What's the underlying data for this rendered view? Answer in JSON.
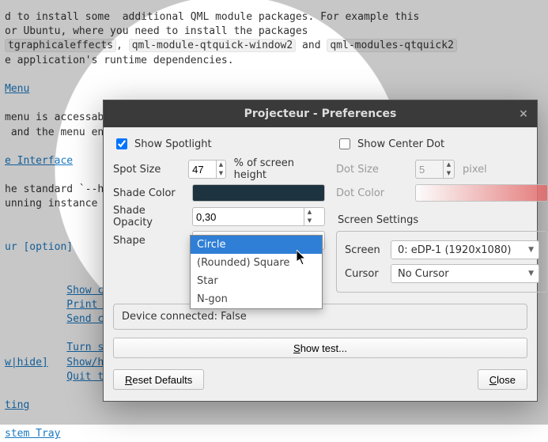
{
  "doc": {
    "line1a": "d to install some  additional QML module packages. For example this",
    "line2a": "or Ubuntu, where you need to install the packages",
    "code1": "tgraphicaleffects",
    "code2": "qml-module-qtquick-window2",
    "code3": "qml-modules-qtquick2",
    "line3b": "e application's runtime dependencies.",
    "h_menu": "Menu",
    "menu_l1": "menu is accessable via the system tray icon. There you will find",
    "menu_l2": " and the menu entries.",
    "h_iface": "e Interface",
    "iface_l1": "he standard `--he",
    "iface_l2": "unning instance a",
    "code_opt": "ur [option]",
    "bul1": "Show co",
    "bul2": "Print a",
    "bul3": "Send co",
    "bul4": "Turn sp",
    "bul5a": "w|hide]",
    "bul5b": "Show/hi",
    "bul6": "Quit t",
    "h_ting": "ting",
    "link_systray": "stem Tray"
  },
  "dialog": {
    "title": "Projecteur - Preferences",
    "show_spotlight": "Show Spotlight",
    "show_centerdot": "Show Center Dot",
    "spot_size_label": "Spot Size",
    "spot_size_value": "47",
    "spot_size_suffix": "% of screen height",
    "shade_color_label": "Shade Color",
    "shade_color_value": "#1d3340",
    "shade_opacity_label": "Shade Opacity",
    "shade_opacity_value": "0,30",
    "shape_label": "Shape",
    "shape_options": [
      "Circle",
      "(Rounded) Square",
      "Star",
      "N-gon"
    ],
    "shape_selected": "Circle",
    "dot_size_label": "Dot Size",
    "dot_size_value": "5",
    "dot_size_suffix": "pixel",
    "dot_color_label": "Dot Color",
    "dot_color_value": "#e36767",
    "screen_settings_h": "Screen Settings",
    "screen_label": "Screen",
    "screen_value": "0: eDP-1 (1920x1080)",
    "cursor_label": "Cursor",
    "cursor_value": "No Cursor",
    "status": "Device connected: False",
    "btn_showtest": "Show test...",
    "btn_reset": "Reset Defaults",
    "btn_close": "Close"
  }
}
